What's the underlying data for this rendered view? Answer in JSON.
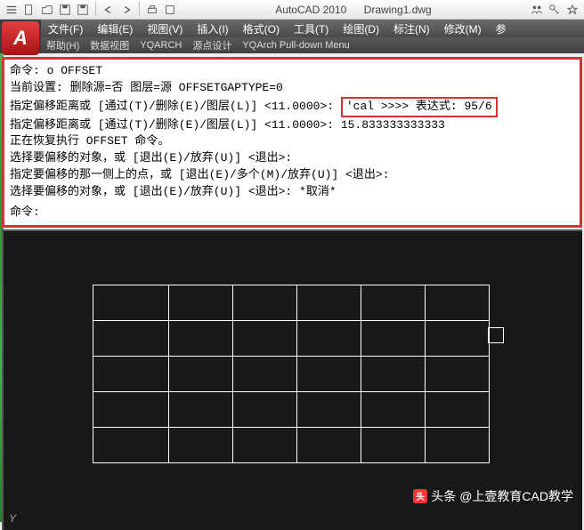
{
  "title": {
    "app": "AutoCAD 2010",
    "doc": "Drawing1.dwg"
  },
  "qat_icons": [
    "menu",
    "new",
    "open",
    "save",
    "saveas",
    "undo",
    "redo",
    "print",
    "plot"
  ],
  "title_right_icons": [
    "person-group",
    "key",
    "star"
  ],
  "menubar": [
    {
      "label": "文件(F)"
    },
    {
      "label": "编辑(E)"
    },
    {
      "label": "视图(V)"
    },
    {
      "label": "插入(I)"
    },
    {
      "label": "格式(O)"
    },
    {
      "label": "工具(T)"
    },
    {
      "label": "绘图(D)"
    },
    {
      "label": "标注(N)"
    },
    {
      "label": "修改(M)"
    },
    {
      "label": "参"
    }
  ],
  "toolbar2": [
    {
      "label": "帮助(H)"
    },
    {
      "label": "数据视图"
    },
    {
      "label": "YQARCH"
    },
    {
      "label": "源点设计"
    },
    {
      "label": "YQArch Pull-down Menu"
    }
  ],
  "cmd": {
    "lines": [
      "命令: o OFFSET",
      "当前设置: 删除源=否  图层=源  OFFSETGAPTYPE=0",
      "指定偏移距离或 [通过(T)/删除(E)/图层(L)] <11.0000>:  ",
      "指定偏移距离或 [通过(T)/删除(E)/图层(L)] <11.0000>:   15.833333333333",
      "正在恢复执行 OFFSET 命令。",
      "选择要偏移的对象，或 [退出(E)/放弃(U)] <退出>:",
      "指定要偏移的那一侧上的点，或 [退出(E)/多个(M)/放弃(U)] <退出>:",
      "选择要偏移的对象，或 [退出(E)/放弃(U)] <退出>:  *取消*"
    ],
    "highlight": "'cal >>>> 表达式: 95/6",
    "prompt_label": "命令:",
    "prompt_value": ""
  },
  "axis": {
    "y": "Y"
  },
  "watermark": {
    "logo": "头",
    "prefix": "头条",
    "text": "@上壹教育CAD教学"
  }
}
